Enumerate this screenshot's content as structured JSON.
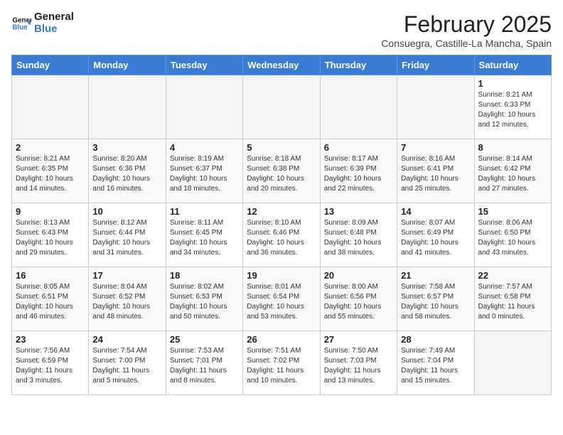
{
  "header": {
    "logo_line1": "General",
    "logo_line2": "Blue",
    "title": "February 2025",
    "subtitle": "Consuegra, Castille-La Mancha, Spain"
  },
  "days_of_week": [
    "Sunday",
    "Monday",
    "Tuesday",
    "Wednesday",
    "Thursday",
    "Friday",
    "Saturday"
  ],
  "weeks": [
    [
      {
        "day": "",
        "info": ""
      },
      {
        "day": "",
        "info": ""
      },
      {
        "day": "",
        "info": ""
      },
      {
        "day": "",
        "info": ""
      },
      {
        "day": "",
        "info": ""
      },
      {
        "day": "",
        "info": ""
      },
      {
        "day": "1",
        "info": "Sunrise: 8:21 AM\nSunset: 6:33 PM\nDaylight: 10 hours\nand 12 minutes."
      }
    ],
    [
      {
        "day": "2",
        "info": "Sunrise: 8:21 AM\nSunset: 6:35 PM\nDaylight: 10 hours\nand 14 minutes."
      },
      {
        "day": "3",
        "info": "Sunrise: 8:20 AM\nSunset: 6:36 PM\nDaylight: 10 hours\nand 16 minutes."
      },
      {
        "day": "4",
        "info": "Sunrise: 8:19 AM\nSunset: 6:37 PM\nDaylight: 10 hours\nand 18 minutes."
      },
      {
        "day": "5",
        "info": "Sunrise: 8:18 AM\nSunset: 6:38 PM\nDaylight: 10 hours\nand 20 minutes."
      },
      {
        "day": "6",
        "info": "Sunrise: 8:17 AM\nSunset: 6:39 PM\nDaylight: 10 hours\nand 22 minutes."
      },
      {
        "day": "7",
        "info": "Sunrise: 8:16 AM\nSunset: 6:41 PM\nDaylight: 10 hours\nand 25 minutes."
      },
      {
        "day": "8",
        "info": "Sunrise: 8:14 AM\nSunset: 6:42 PM\nDaylight: 10 hours\nand 27 minutes."
      }
    ],
    [
      {
        "day": "9",
        "info": "Sunrise: 8:13 AM\nSunset: 6:43 PM\nDaylight: 10 hours\nand 29 minutes."
      },
      {
        "day": "10",
        "info": "Sunrise: 8:12 AM\nSunset: 6:44 PM\nDaylight: 10 hours\nand 31 minutes."
      },
      {
        "day": "11",
        "info": "Sunrise: 8:11 AM\nSunset: 6:45 PM\nDaylight: 10 hours\nand 34 minutes."
      },
      {
        "day": "12",
        "info": "Sunrise: 8:10 AM\nSunset: 6:46 PM\nDaylight: 10 hours\nand 36 minutes."
      },
      {
        "day": "13",
        "info": "Sunrise: 8:09 AM\nSunset: 6:48 PM\nDaylight: 10 hours\nand 38 minutes."
      },
      {
        "day": "14",
        "info": "Sunrise: 8:07 AM\nSunset: 6:49 PM\nDaylight: 10 hours\nand 41 minutes."
      },
      {
        "day": "15",
        "info": "Sunrise: 8:06 AM\nSunset: 6:50 PM\nDaylight: 10 hours\nand 43 minutes."
      }
    ],
    [
      {
        "day": "16",
        "info": "Sunrise: 8:05 AM\nSunset: 6:51 PM\nDaylight: 10 hours\nand 46 minutes."
      },
      {
        "day": "17",
        "info": "Sunrise: 8:04 AM\nSunset: 6:52 PM\nDaylight: 10 hours\nand 48 minutes."
      },
      {
        "day": "18",
        "info": "Sunrise: 8:02 AM\nSunset: 6:53 PM\nDaylight: 10 hours\nand 50 minutes."
      },
      {
        "day": "19",
        "info": "Sunrise: 8:01 AM\nSunset: 6:54 PM\nDaylight: 10 hours\nand 53 minutes."
      },
      {
        "day": "20",
        "info": "Sunrise: 8:00 AM\nSunset: 6:56 PM\nDaylight: 10 hours\nand 55 minutes."
      },
      {
        "day": "21",
        "info": "Sunrise: 7:58 AM\nSunset: 6:57 PM\nDaylight: 10 hours\nand 58 minutes."
      },
      {
        "day": "22",
        "info": "Sunrise: 7:57 AM\nSunset: 6:58 PM\nDaylight: 11 hours\nand 0 minutes."
      }
    ],
    [
      {
        "day": "23",
        "info": "Sunrise: 7:56 AM\nSunset: 6:59 PM\nDaylight: 11 hours\nand 3 minutes."
      },
      {
        "day": "24",
        "info": "Sunrise: 7:54 AM\nSunset: 7:00 PM\nDaylight: 11 hours\nand 5 minutes."
      },
      {
        "day": "25",
        "info": "Sunrise: 7:53 AM\nSunset: 7:01 PM\nDaylight: 11 hours\nand 8 minutes."
      },
      {
        "day": "26",
        "info": "Sunrise: 7:51 AM\nSunset: 7:02 PM\nDaylight: 11 hours\nand 10 minutes."
      },
      {
        "day": "27",
        "info": "Sunrise: 7:50 AM\nSunset: 7:03 PM\nDaylight: 11 hours\nand 13 minutes."
      },
      {
        "day": "28",
        "info": "Sunrise: 7:49 AM\nSunset: 7:04 PM\nDaylight: 11 hours\nand 15 minutes."
      },
      {
        "day": "",
        "info": ""
      }
    ]
  ]
}
